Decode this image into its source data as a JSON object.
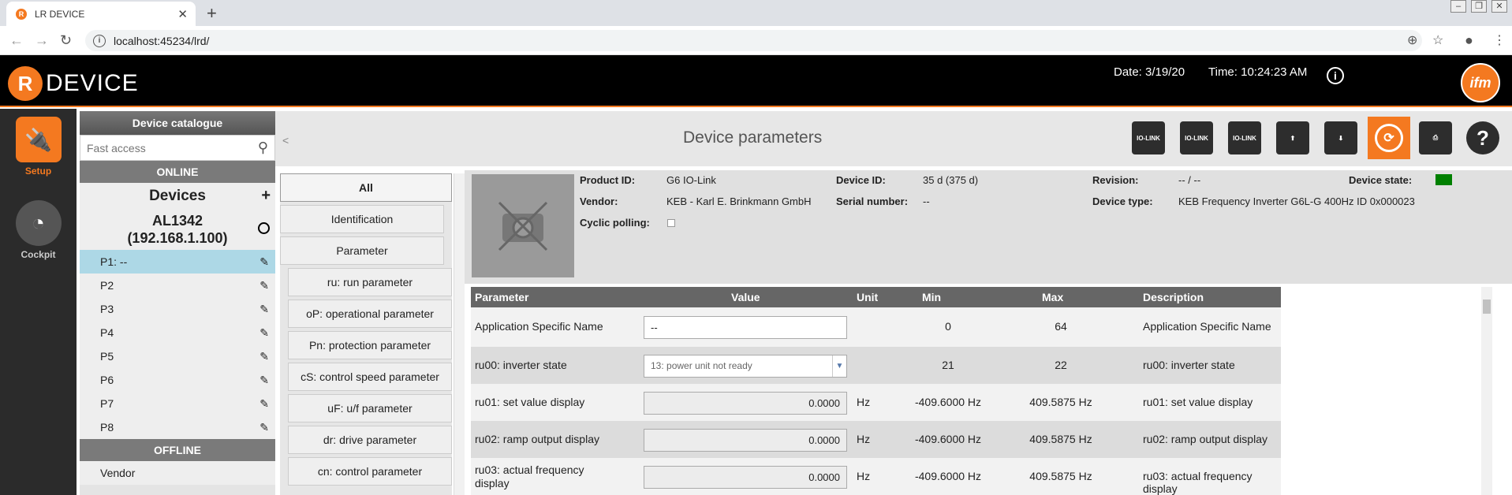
{
  "browser": {
    "tab_title": "LR DEVICE",
    "url": "localhost:45234/lrd/"
  },
  "header": {
    "logo_text": "DEVICE",
    "date": "Date: 3/19/20",
    "time": "Time: 10:24:23 AM"
  },
  "sidebar": {
    "setup_label": "Setup",
    "cockpit_label": "Cockpit"
  },
  "catalog": {
    "title": "Device catalogue",
    "search_placeholder": "Fast access",
    "online_label": "ONLINE",
    "devices_label": "Devices",
    "device_name": "AL1342",
    "device_ip": "(192.168.1.100)",
    "ports": [
      "P1: --",
      "P2",
      "P3",
      "P4",
      "P5",
      "P6",
      "P7",
      "P8"
    ],
    "offline_label": "OFFLINE",
    "vendor_label": "Vendor"
  },
  "page": {
    "title": "Device parameters",
    "collapse": "<"
  },
  "toolbar": {
    "upload_label": "IO-LINK",
    "download_label": "IO-LINK",
    "sync_label": "IO-LINK"
  },
  "menu": {
    "items": [
      "All",
      "Identification",
      "Parameter",
      "ru: run parameter",
      "oP: operational parameter",
      "Pn: protection parameter",
      "cS: control speed parameter",
      "uF: u/f parameter",
      "dr: drive parameter",
      "cn: control parameter"
    ]
  },
  "device_info": {
    "product_id_label": "Product ID:",
    "product_id": "G6 IO-Link",
    "vendor_label": "Vendor:",
    "vendor": "KEB - Karl E. Brinkmann GmbH",
    "cyclic_label": "Cyclic polling:",
    "device_id_label": "Device ID:",
    "device_id": "35 d (375 d)",
    "serial_label": "Serial number:",
    "serial": "--",
    "revision_label": "Revision:",
    "revision": "-- / --",
    "device_type_label": "Device type:",
    "device_type": "KEB Frequency Inverter G6L-G 400Hz ID 0x000023",
    "device_state_label": "Device state:",
    "state_color": "#008000"
  },
  "table": {
    "headers": [
      "Parameter",
      "Value",
      "Unit",
      "Min",
      "Max",
      "Description"
    ],
    "rows": [
      {
        "param": "Application Specific Name",
        "value": "--",
        "unit": "",
        "min": "0",
        "max": "64",
        "desc": "Application Specific Name"
      },
      {
        "param": "ru00: inverter state",
        "value": "13: power unit not ready",
        "unit": "",
        "min": "21",
        "max": "22",
        "desc": "ru00: inverter state"
      },
      {
        "param": "ru01: set value display",
        "value": "0.0000",
        "unit": "Hz",
        "min": "-409.6000 Hz",
        "max": "409.5875 Hz",
        "desc": "ru01: set value display"
      },
      {
        "param": "ru02: ramp output display",
        "value": "0.0000",
        "unit": "Hz",
        "min": "-409.6000 Hz",
        "max": "409.5875 Hz",
        "desc": "ru02: ramp output display"
      },
      {
        "param": "ru03: actual frequency display",
        "value": "0.0000",
        "unit": "Hz",
        "min": "-409.6000 Hz",
        "max": "409.5875 Hz",
        "desc": "ru03: actual frequency display"
      }
    ]
  }
}
